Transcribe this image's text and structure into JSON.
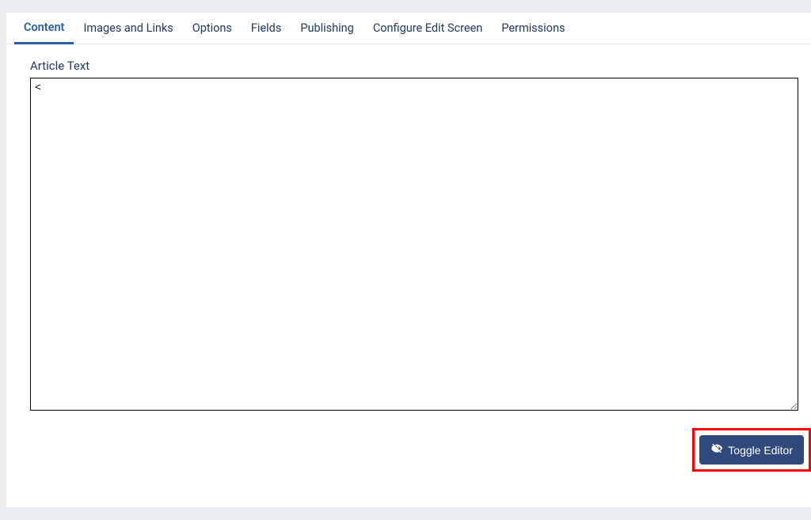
{
  "tabs": [
    {
      "label": "Content",
      "active": true
    },
    {
      "label": "Images and Links",
      "active": false
    },
    {
      "label": "Options",
      "active": false
    },
    {
      "label": "Fields",
      "active": false
    },
    {
      "label": "Publishing",
      "active": false
    },
    {
      "label": "Configure Edit Screen",
      "active": false
    },
    {
      "label": "Permissions",
      "active": false
    }
  ],
  "field": {
    "label": "Article Text",
    "value": "<"
  },
  "toggle_button": {
    "label": "Toggle Editor"
  },
  "colors": {
    "accent": "#2a5faa",
    "button": "#2f497b",
    "text": "#1f3b64",
    "highlight": "#ff0000"
  }
}
